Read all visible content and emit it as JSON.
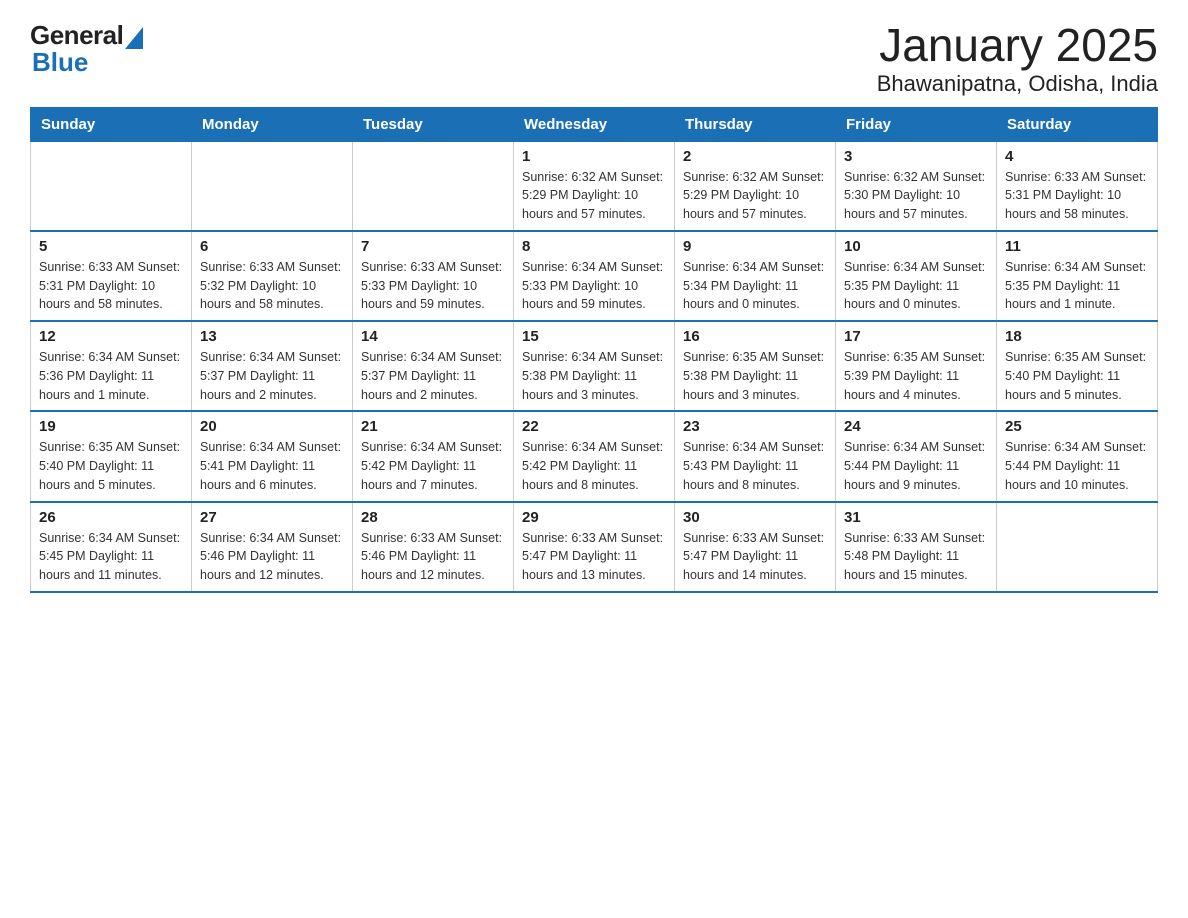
{
  "header": {
    "logo_general": "General",
    "logo_blue": "Blue",
    "month_title": "January 2025",
    "location": "Bhawanipatna, Odisha, India"
  },
  "weekdays": [
    "Sunday",
    "Monday",
    "Tuesday",
    "Wednesday",
    "Thursday",
    "Friday",
    "Saturday"
  ],
  "weeks": [
    [
      {
        "day": "",
        "info": ""
      },
      {
        "day": "",
        "info": ""
      },
      {
        "day": "",
        "info": ""
      },
      {
        "day": "1",
        "info": "Sunrise: 6:32 AM\nSunset: 5:29 PM\nDaylight: 10 hours and 57 minutes."
      },
      {
        "day": "2",
        "info": "Sunrise: 6:32 AM\nSunset: 5:29 PM\nDaylight: 10 hours and 57 minutes."
      },
      {
        "day": "3",
        "info": "Sunrise: 6:32 AM\nSunset: 5:30 PM\nDaylight: 10 hours and 57 minutes."
      },
      {
        "day": "4",
        "info": "Sunrise: 6:33 AM\nSunset: 5:31 PM\nDaylight: 10 hours and 58 minutes."
      }
    ],
    [
      {
        "day": "5",
        "info": "Sunrise: 6:33 AM\nSunset: 5:31 PM\nDaylight: 10 hours and 58 minutes."
      },
      {
        "day": "6",
        "info": "Sunrise: 6:33 AM\nSunset: 5:32 PM\nDaylight: 10 hours and 58 minutes."
      },
      {
        "day": "7",
        "info": "Sunrise: 6:33 AM\nSunset: 5:33 PM\nDaylight: 10 hours and 59 minutes."
      },
      {
        "day": "8",
        "info": "Sunrise: 6:34 AM\nSunset: 5:33 PM\nDaylight: 10 hours and 59 minutes."
      },
      {
        "day": "9",
        "info": "Sunrise: 6:34 AM\nSunset: 5:34 PM\nDaylight: 11 hours and 0 minutes."
      },
      {
        "day": "10",
        "info": "Sunrise: 6:34 AM\nSunset: 5:35 PM\nDaylight: 11 hours and 0 minutes."
      },
      {
        "day": "11",
        "info": "Sunrise: 6:34 AM\nSunset: 5:35 PM\nDaylight: 11 hours and 1 minute."
      }
    ],
    [
      {
        "day": "12",
        "info": "Sunrise: 6:34 AM\nSunset: 5:36 PM\nDaylight: 11 hours and 1 minute."
      },
      {
        "day": "13",
        "info": "Sunrise: 6:34 AM\nSunset: 5:37 PM\nDaylight: 11 hours and 2 minutes."
      },
      {
        "day": "14",
        "info": "Sunrise: 6:34 AM\nSunset: 5:37 PM\nDaylight: 11 hours and 2 minutes."
      },
      {
        "day": "15",
        "info": "Sunrise: 6:34 AM\nSunset: 5:38 PM\nDaylight: 11 hours and 3 minutes."
      },
      {
        "day": "16",
        "info": "Sunrise: 6:35 AM\nSunset: 5:38 PM\nDaylight: 11 hours and 3 minutes."
      },
      {
        "day": "17",
        "info": "Sunrise: 6:35 AM\nSunset: 5:39 PM\nDaylight: 11 hours and 4 minutes."
      },
      {
        "day": "18",
        "info": "Sunrise: 6:35 AM\nSunset: 5:40 PM\nDaylight: 11 hours and 5 minutes."
      }
    ],
    [
      {
        "day": "19",
        "info": "Sunrise: 6:35 AM\nSunset: 5:40 PM\nDaylight: 11 hours and 5 minutes."
      },
      {
        "day": "20",
        "info": "Sunrise: 6:34 AM\nSunset: 5:41 PM\nDaylight: 11 hours and 6 minutes."
      },
      {
        "day": "21",
        "info": "Sunrise: 6:34 AM\nSunset: 5:42 PM\nDaylight: 11 hours and 7 minutes."
      },
      {
        "day": "22",
        "info": "Sunrise: 6:34 AM\nSunset: 5:42 PM\nDaylight: 11 hours and 8 minutes."
      },
      {
        "day": "23",
        "info": "Sunrise: 6:34 AM\nSunset: 5:43 PM\nDaylight: 11 hours and 8 minutes."
      },
      {
        "day": "24",
        "info": "Sunrise: 6:34 AM\nSunset: 5:44 PM\nDaylight: 11 hours and 9 minutes."
      },
      {
        "day": "25",
        "info": "Sunrise: 6:34 AM\nSunset: 5:44 PM\nDaylight: 11 hours and 10 minutes."
      }
    ],
    [
      {
        "day": "26",
        "info": "Sunrise: 6:34 AM\nSunset: 5:45 PM\nDaylight: 11 hours and 11 minutes."
      },
      {
        "day": "27",
        "info": "Sunrise: 6:34 AM\nSunset: 5:46 PM\nDaylight: 11 hours and 12 minutes."
      },
      {
        "day": "28",
        "info": "Sunrise: 6:33 AM\nSunset: 5:46 PM\nDaylight: 11 hours and 12 minutes."
      },
      {
        "day": "29",
        "info": "Sunrise: 6:33 AM\nSunset: 5:47 PM\nDaylight: 11 hours and 13 minutes."
      },
      {
        "day": "30",
        "info": "Sunrise: 6:33 AM\nSunset: 5:47 PM\nDaylight: 11 hours and 14 minutes."
      },
      {
        "day": "31",
        "info": "Sunrise: 6:33 AM\nSunset: 5:48 PM\nDaylight: 11 hours and 15 minutes."
      },
      {
        "day": "",
        "info": ""
      }
    ]
  ]
}
